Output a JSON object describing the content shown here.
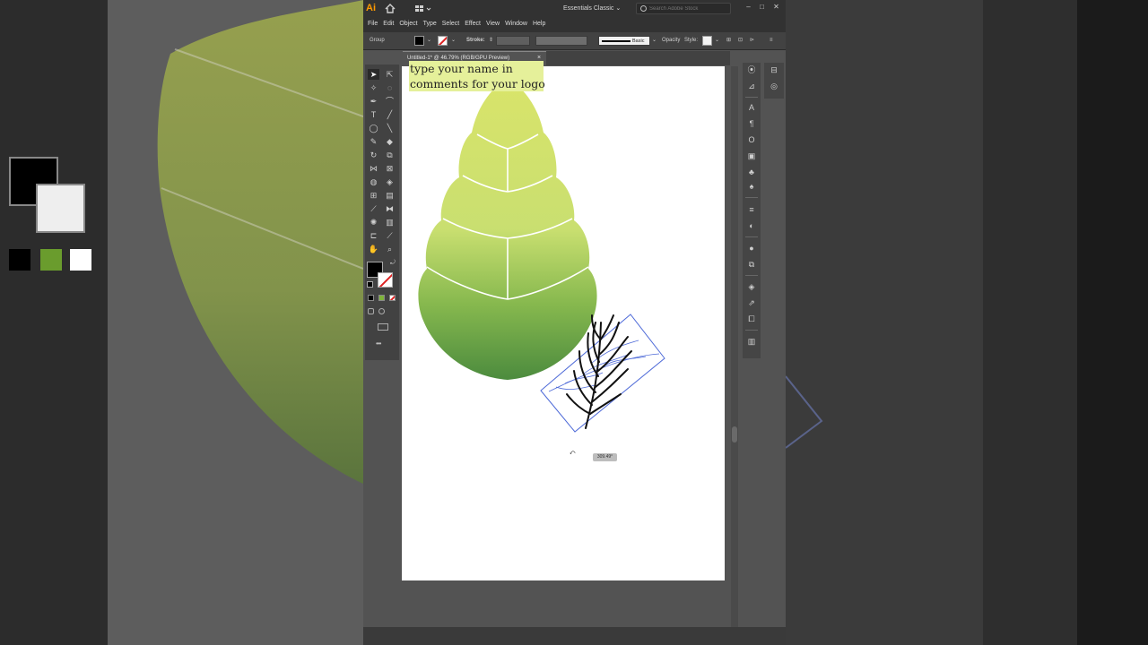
{
  "app": {
    "logo_text": "Ai",
    "workspace": "Essentials Classic",
    "search_placeholder": "Search Adobe Stock",
    "window_controls": [
      "–",
      "□",
      "✕"
    ]
  },
  "menu": [
    "File",
    "Edit",
    "Object",
    "Type",
    "Select",
    "Effect",
    "View",
    "Window",
    "Help"
  ],
  "control_bar": {
    "selection_label": "Group",
    "stroke_label": "Stroke:",
    "brush_label": "Basic",
    "opacity_label": "Opacity",
    "style_label": "Style:"
  },
  "document": {
    "tab_title": "Untitled-1* @ 46.79% (RGB/GPU Preview)",
    "close": "×"
  },
  "canvas": {
    "headline_line1": "type your name in",
    "headline_line2": "comments for your logo",
    "rotate_angle": "309.49°",
    "leaf_colors": {
      "top": "#d9e46a",
      "mid": "#c4dc6e",
      "bottom": "#4c8b3e"
    },
    "selection_color": "#4f6bd8"
  },
  "tools": {
    "more_label": "•••"
  }
}
